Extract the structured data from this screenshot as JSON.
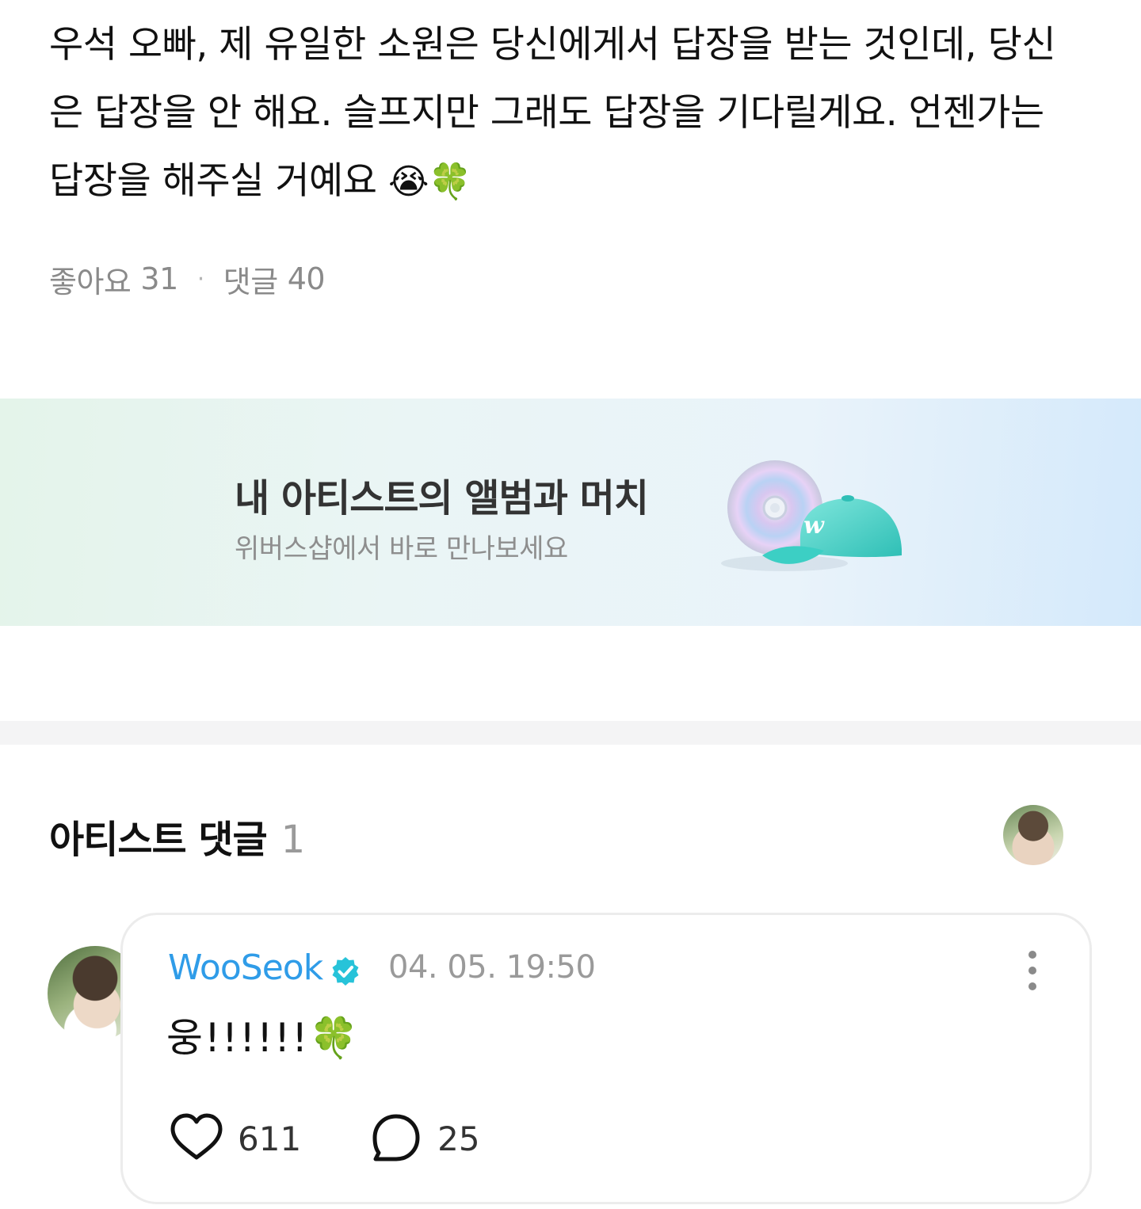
{
  "post": {
    "text_part1": "우석 오빠, 제 유일한 소원은 당신에게서 답장을 받는 것인데, 당신은 답장을 안 해요. 슬프지만 그래도 답장을 기다릴게요. 언젠가는 답장을 해주실 거예요 ",
    "emoji_cry": "😭",
    "emoji_clover": "🍀",
    "likes_label": "좋아요",
    "likes_count": "31",
    "separator": "·",
    "comments_label": "댓글",
    "comments_count": "40"
  },
  "banner": {
    "title": "내 아티스트의 앨범과 머치",
    "subtitle": "위버스샵에서 바로 만나보세요",
    "cap_logo": "w"
  },
  "artist_comments": {
    "section_title": "아티스트 댓글",
    "count": "1"
  },
  "comment": {
    "author": "WooSeok",
    "timestamp": "04. 05. 19:50",
    "body": "웅!!!!!!",
    "emoji": "🍀",
    "like_count": "611",
    "reply_count": "25"
  },
  "colors": {
    "author_blue": "#2f9ce8",
    "verified_badge": "#27c3d9",
    "muted_text": "#8a8a8a"
  }
}
